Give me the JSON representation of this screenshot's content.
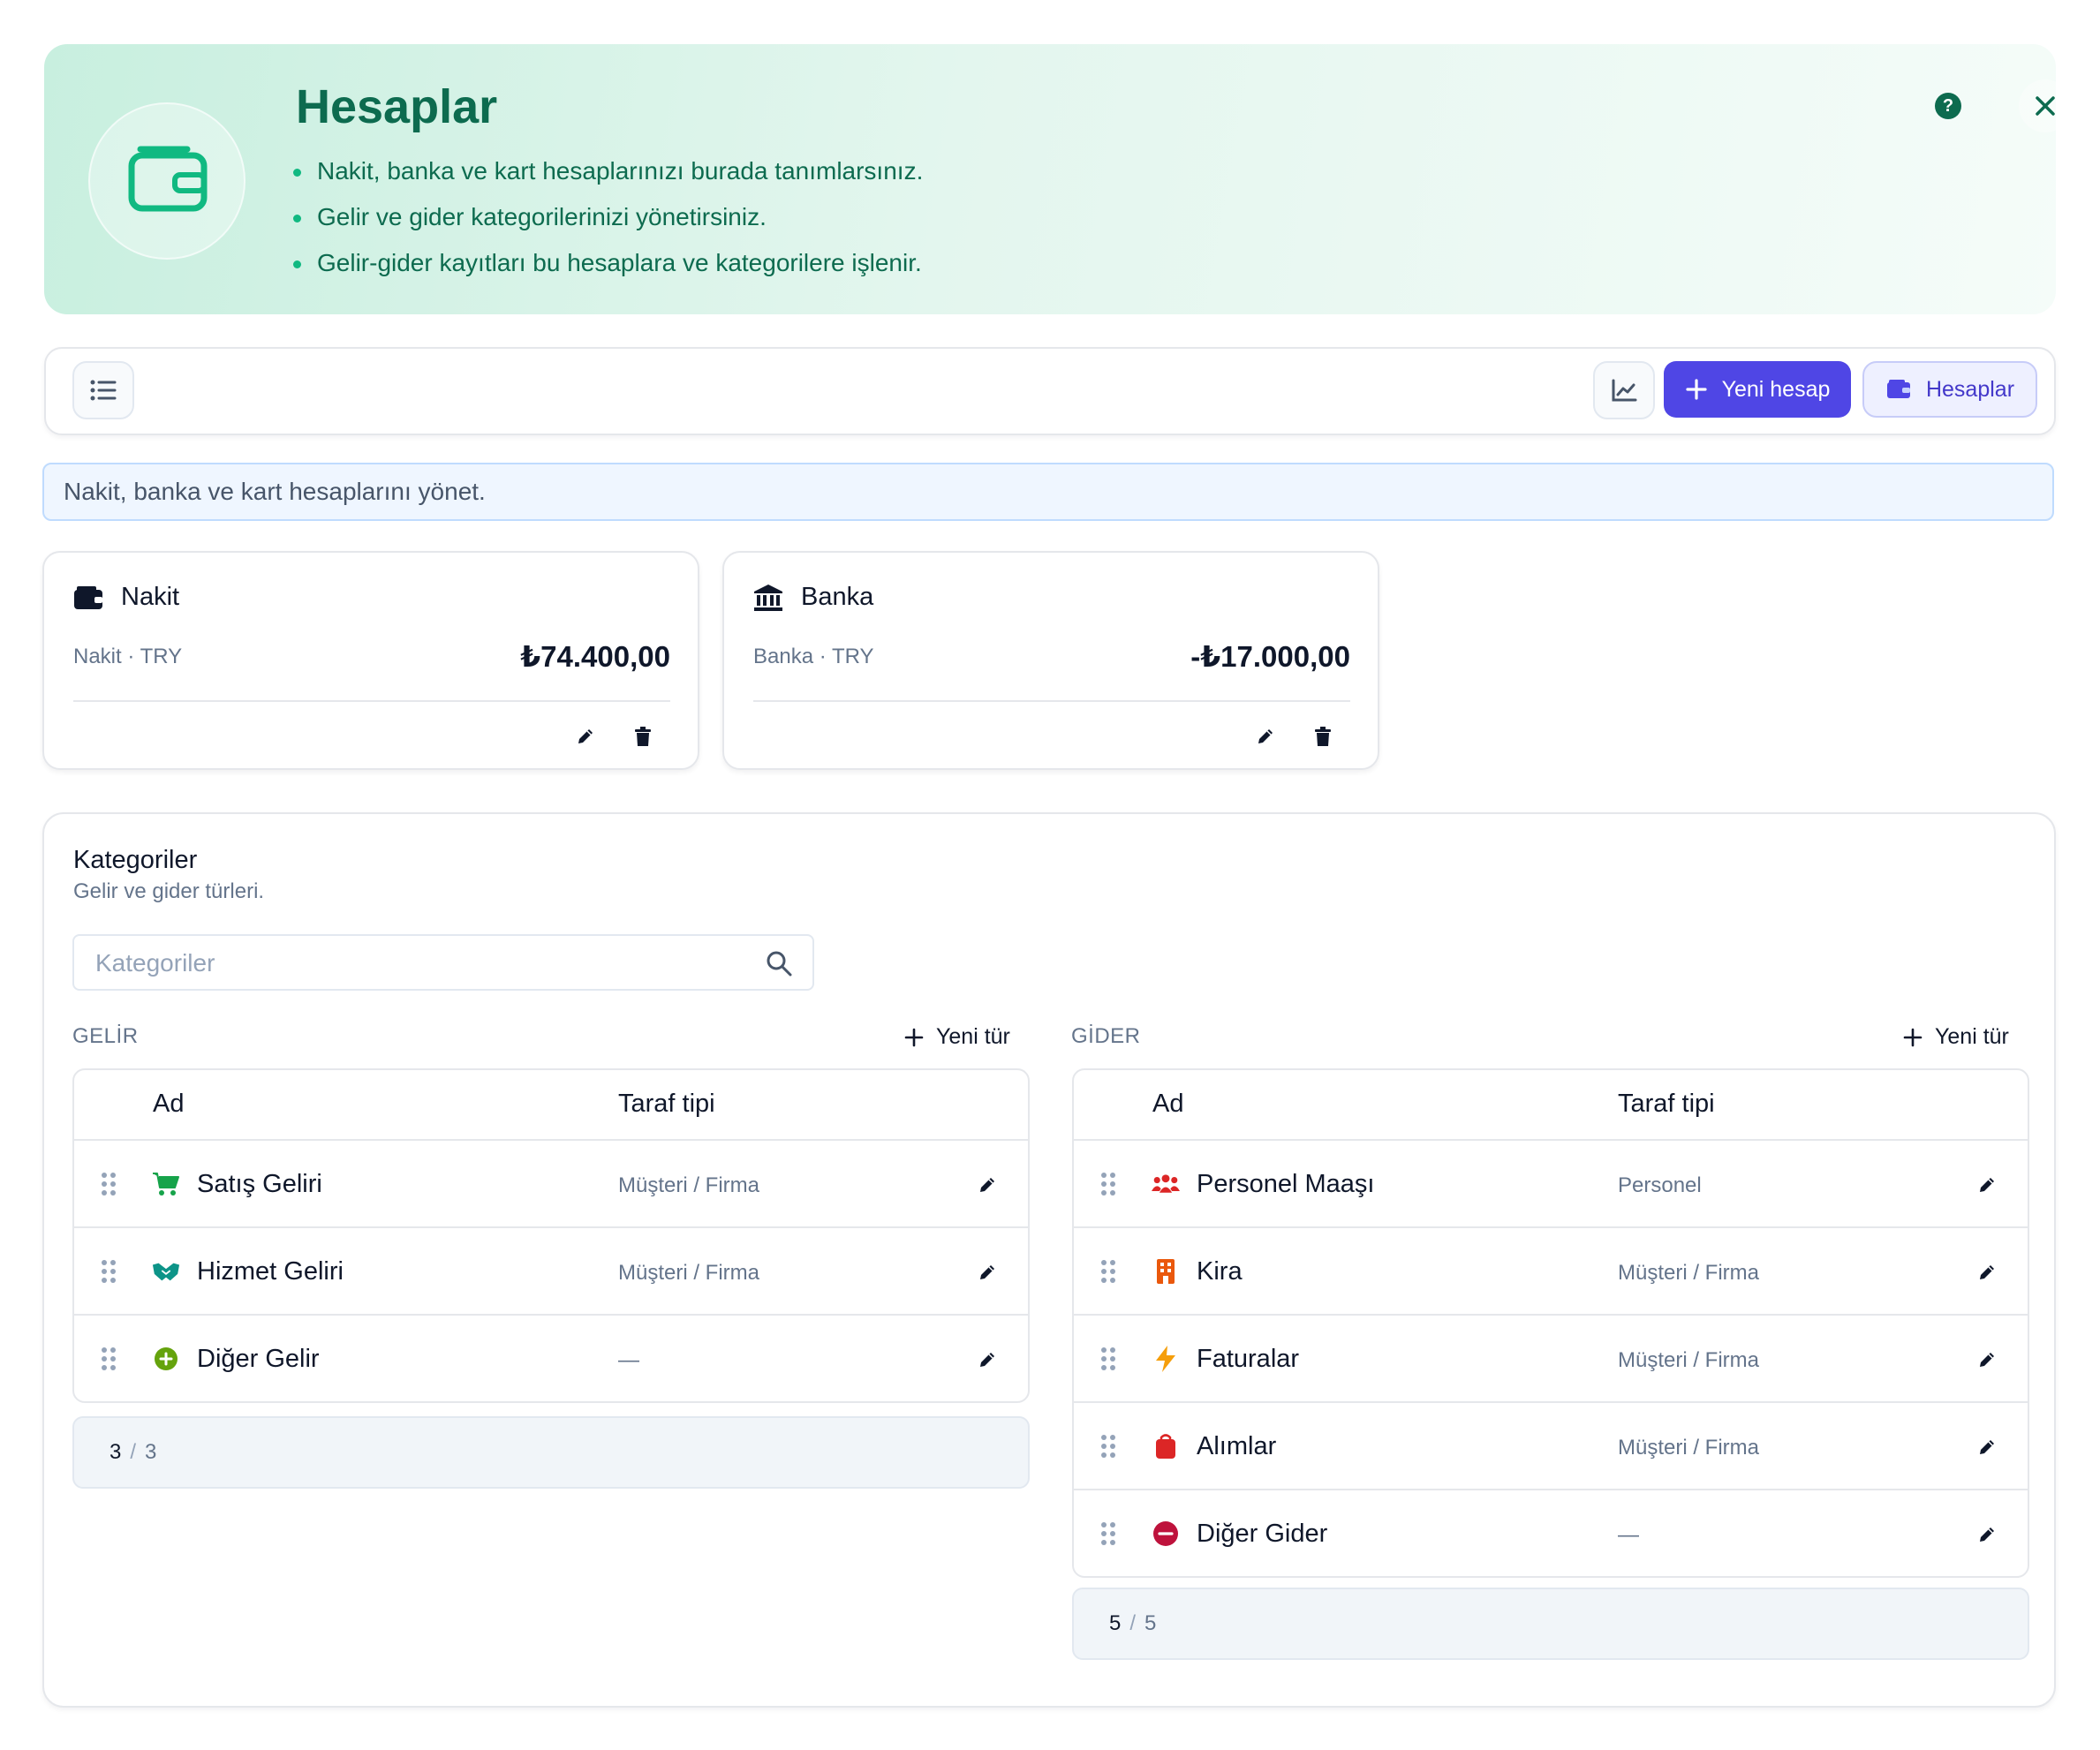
{
  "banner": {
    "title": "Hesaplar",
    "bullets": [
      "Nakit, banka ve kart hesaplarınızı burada tanımlarsınız.",
      "Gelir ve gider kategorilerinizi yönetirsiniz.",
      "Gelir-gider kayıtları bu hesaplara ve kategorilere işlenir."
    ],
    "icon": "wallet-icon",
    "help_icon": "help-circle-icon",
    "close_icon": "close-icon"
  },
  "toolbar": {
    "list_icon": "list-icon",
    "chart_icon": "line-chart-icon",
    "new_account_label": "Yeni hesap",
    "accounts_label": "Hesaplar"
  },
  "info": "Nakit, banka ve kart hesaplarını yönet.",
  "accounts": [
    {
      "name": "Nakit",
      "sub": "Nakit · TRY",
      "amount": "₺74.400,00",
      "icon": "wallet-icon"
    },
    {
      "name": "Banka",
      "sub": "Banka · TRY",
      "amount": "-₺17.000,00",
      "icon": "bank-icon"
    }
  ],
  "categories": {
    "title": "Kategoriler",
    "subtitle": "Gelir ve gider türleri.",
    "search_placeholder": "Kategoriler",
    "new_type_label": "Yeni tür",
    "columns": {
      "name": "Ad",
      "party": "Taraf tipi"
    },
    "income": {
      "label": "GELİR",
      "rows": [
        {
          "name": "Satış Geliri",
          "party": "Müşteri / Firma",
          "icon": "cart-icon",
          "color": "#16a34a"
        },
        {
          "name": "Hizmet Geliri",
          "party": "Müşteri / Firma",
          "icon": "handshake-icon",
          "color": "#0d9488"
        },
        {
          "name": "Diğer Gelir",
          "party": "—",
          "icon": "plus-circle-icon",
          "color": "#65a30d"
        }
      ],
      "pager": {
        "shown": "3",
        "total": "3"
      }
    },
    "expense": {
      "label": "GİDER",
      "rows": [
        {
          "name": "Personel Maaşı",
          "party": "Personel",
          "icon": "users-icon",
          "color": "#dc2626"
        },
        {
          "name": "Kira",
          "party": "Müşteri / Firma",
          "icon": "building-icon",
          "color": "#ea580c"
        },
        {
          "name": "Faturalar",
          "party": "Müşteri / Firma",
          "icon": "bolt-icon",
          "color": "#f59e0b"
        },
        {
          "name": "Alımlar",
          "party": "Müşteri / Firma",
          "icon": "bag-icon",
          "color": "#dc2626"
        },
        {
          "name": "Diğer Gider",
          "party": "—",
          "icon": "minus-circle-icon",
          "color": "#be123c"
        }
      ],
      "pager": {
        "shown": "5",
        "total": "5"
      }
    }
  },
  "colors": {
    "brand": "#0d6b4f",
    "accent": "#4f46e5",
    "banner_bg": "#d9f3e8"
  }
}
